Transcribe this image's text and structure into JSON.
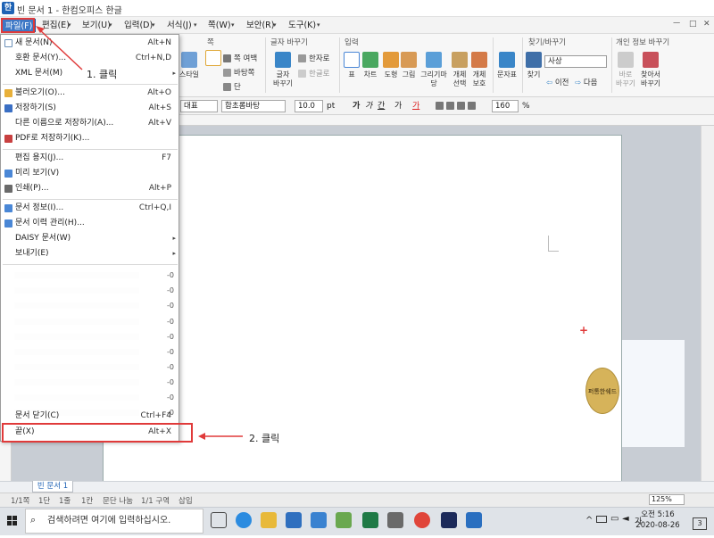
{
  "window": {
    "title": "빈 문서 1 - 한컴오피스 한글",
    "controls": [
      "ㅡ",
      "□",
      "✕"
    ]
  },
  "menubar": {
    "items": [
      {
        "label": "파일(F)",
        "active": true
      },
      {
        "label": "편집(E)"
      },
      {
        "label": "보기(U)"
      },
      {
        "label": "입력(D)"
      },
      {
        "label": "서식(J)"
      },
      {
        "label": "쪽(W)"
      },
      {
        "label": "보안(R)"
      },
      {
        "label": "도구(K)"
      }
    ]
  },
  "ribbon": {
    "groups": {
      "page": "쪽",
      "font_replace": "글자 바꾸기",
      "input": "입력",
      "find": "찾기/바꾸기",
      "privacy": "개인 정보 바꾸기"
    },
    "style_label": "스타일",
    "page_border": "쪽 여백",
    "background": "바탕쪽",
    "column": "단",
    "char_replace": "글자\n바꾸기",
    "hanja": "한자로",
    "hangul": "한글로",
    "table": "표",
    "chart": "차트",
    "shape": "도형",
    "picture": "그림",
    "drawing": "그리기마당",
    "object_select": "개체\n선택",
    "object_protect": "개체\n보호",
    "char_table": "문자표",
    "find_btn": "찾기",
    "prev": "이전",
    "next": "다음",
    "search_value": "사상",
    "privacy_change": "바로\n바꾸기",
    "privacy_find": "찾아서\n바꾸기"
  },
  "formatbar": {
    "style": "대표",
    "font": "함초롬바탕",
    "size": "10.0",
    "unit": "pt",
    "bold": "가",
    "italic": "가",
    "underline": "간",
    "strike": "가",
    "color": "가",
    "zoom": "160",
    "percent": "%"
  },
  "file_menu": {
    "items": [
      {
        "label": "새 문서(N)",
        "shortcut": "Alt+N",
        "icon_color": "#ffffff"
      },
      {
        "label": "호환 문서(Y)...",
        "shortcut": "Ctrl+N,D"
      },
      {
        "label": "XML 문서(M)",
        "submenu": true
      },
      {
        "label": "불러오기(O)...",
        "shortcut": "Alt+O",
        "icon_color": "#e8b03a"
      },
      {
        "label": "저장하기(S)",
        "shortcut": "Alt+S",
        "icon_color": "#3a6fc4"
      },
      {
        "label": "다른 이름으로 저장하기(A)...",
        "shortcut": "Alt+V"
      },
      {
        "label": "PDF로 저장하기(K)...",
        "icon_color": "#c84040"
      },
      {
        "label": "편집 용지(J)...",
        "shortcut": "F7"
      },
      {
        "label": "미리 보기(V)",
        "icon_color": "#4a87d6"
      },
      {
        "label": "인쇄(P)...",
        "shortcut": "Alt+P",
        "icon_color": "#6a6a6a"
      },
      {
        "label": "문서 정보(I)...",
        "shortcut": "Ctrl+Q,I",
        "icon_color": "#4a87d6"
      },
      {
        "label": "문서 이력 관리(H)...",
        "icon_color": "#4a87d6"
      },
      {
        "label": "DAISY 문서(W)",
        "submenu": true
      },
      {
        "label": "보내기(E)",
        "submenu": true
      }
    ],
    "recent_shortcuts": [
      "-0",
      "-0",
      "-0",
      "-0",
      "-0",
      "-0",
      "-0",
      "-0",
      "-0",
      "-0"
    ],
    "close_doc": {
      "label": "문서 닫기(C)",
      "shortcut": "Ctrl+F4"
    },
    "exit": {
      "label": "끝(X)",
      "shortcut": "Alt+X"
    }
  },
  "annotations": {
    "step1": "1. 클릭",
    "step2": "2. 클릭",
    "color": "#e03a3a"
  },
  "document": {
    "tab": "빈 문서 1",
    "stamp_text": "퍼통한쉐드"
  },
  "statusbar": {
    "items": [
      "1/1쪽",
      "1단",
      "1줄",
      "1칸",
      "문단 나눔",
      "1/1 구역",
      "삽입"
    ],
    "zoom": "125%"
  },
  "taskbar": {
    "search_placeholder": "검색하려면 여기에 입력하십시오.",
    "time": "오전 5:16",
    "date": "2020-08-26",
    "lang": "가",
    "notification_count": "3"
  }
}
